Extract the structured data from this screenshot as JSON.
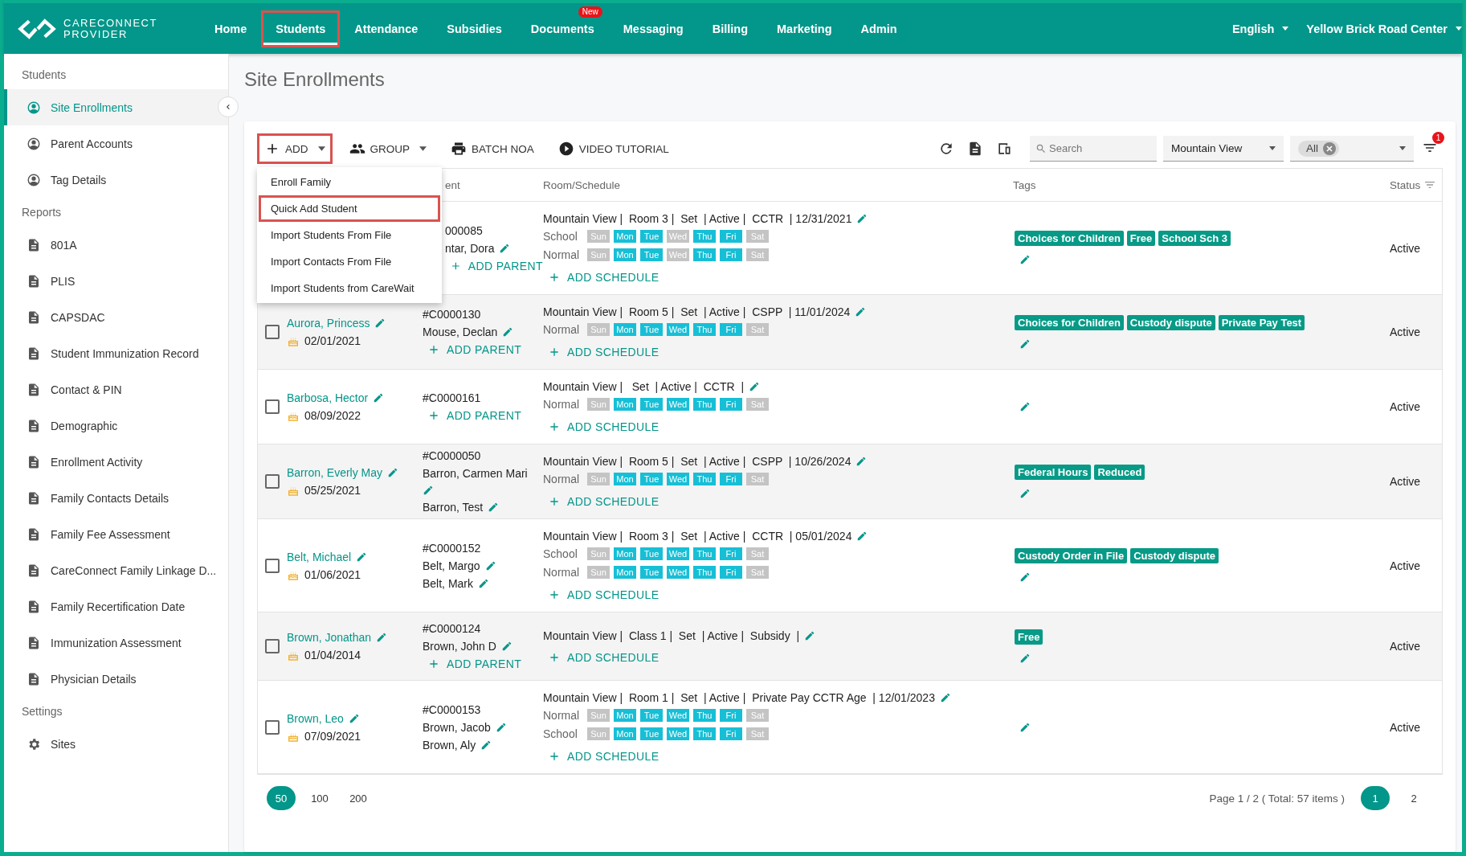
{
  "brand": {
    "line1": "CARECONNECT",
    "line2": "PROVIDER"
  },
  "nav": [
    {
      "label": "Home",
      "selected": false,
      "highlighted": false
    },
    {
      "label": "Students",
      "selected": true,
      "highlighted": true
    },
    {
      "label": "Attendance",
      "selected": false,
      "highlighted": false
    },
    {
      "label": "Subsidies",
      "selected": false,
      "highlighted": false
    },
    {
      "label": "Documents",
      "selected": false,
      "highlighted": false,
      "badge": "New"
    },
    {
      "label": "Messaging",
      "selected": false,
      "highlighted": false
    },
    {
      "label": "Billing",
      "selected": false,
      "highlighted": false
    },
    {
      "label": "Marketing",
      "selected": false,
      "highlighted": false
    },
    {
      "label": "Admin",
      "selected": false,
      "highlighted": false
    }
  ],
  "header_menus": [
    "English",
    "Yellow Brick Road Center"
  ],
  "sidebar": [
    {
      "heading": "Students",
      "items": [
        {
          "label": "Site Enrollments",
          "kind": "person",
          "selected": true
        },
        {
          "label": "Parent Accounts",
          "kind": "person",
          "selected": false
        },
        {
          "label": "Tag Details",
          "kind": "person",
          "selected": false
        }
      ]
    },
    {
      "heading": "Reports",
      "items": [
        {
          "label": "801A",
          "kind": "report",
          "selected": false
        },
        {
          "label": "PLIS",
          "kind": "report",
          "selected": false
        },
        {
          "label": "CAPSDAC",
          "kind": "report",
          "selected": false
        },
        {
          "label": "Student Immunization Record",
          "kind": "report",
          "selected": false
        },
        {
          "label": "Contact & PIN",
          "kind": "report",
          "selected": false
        },
        {
          "label": "Demographic",
          "kind": "report",
          "selected": false
        },
        {
          "label": "Enrollment Activity",
          "kind": "report",
          "selected": false
        },
        {
          "label": "Family Contacts Details",
          "kind": "report",
          "selected": false
        },
        {
          "label": "Family Fee Assessment",
          "kind": "report",
          "selected": false
        },
        {
          "label": "CareConnect Family Linkage D...",
          "kind": "report",
          "selected": false
        },
        {
          "label": "Family Recertification Date",
          "kind": "report",
          "selected": false
        },
        {
          "label": "Immunization Assessment",
          "kind": "report",
          "selected": false
        },
        {
          "label": "Physician Details",
          "kind": "report",
          "selected": false
        }
      ]
    },
    {
      "heading": "Settings",
      "items": [
        {
          "label": "Sites",
          "kind": "setting",
          "selected": false
        }
      ]
    }
  ],
  "page_title": "Site Enrollments",
  "toolbar": {
    "actions": [
      {
        "label": "ADD",
        "kind": "add",
        "highlighted": true
      },
      {
        "label": "GROUP",
        "kind": "group",
        "highlighted": false
      },
      {
        "label": "BATCH NOA",
        "kind": "print",
        "highlighted": false
      },
      {
        "label": "VIDEO TUTORIAL",
        "kind": "video",
        "highlighted": false
      }
    ],
    "search": {
      "placeholder": "Search"
    },
    "site": "Mountain View",
    "filter_chip": "All",
    "filter_badge": "1"
  },
  "add_menu": {
    "expanded": true,
    "items": [
      {
        "label": "Enroll Family",
        "highlighted": false
      },
      {
        "label": "Quick Add Student",
        "highlighted": true
      },
      {
        "label": "Import Students From File",
        "highlighted": false
      },
      {
        "label": "Import Contacts From File",
        "highlighted": false
      },
      {
        "label": "Import Students from CareWait",
        "highlighted": false
      }
    ]
  },
  "columns": {
    "parent": "ent",
    "schedule": "Room/Schedule",
    "tags": "Tags",
    "status": "Status"
  },
  "rows": [
    {
      "account": "000085",
      "parents": [
        "ntar, Dora"
      ],
      "add_parent": "ADD PARENT",
      "schedule_info": "Mountain View |  Room 3 |  Set  | Active |  CCTR  | 12/31/2021",
      "schedules": [
        {
          "label": "School",
          "days": [
            {
              "label": "Sun",
              "on": false
            },
            {
              "label": "Mon",
              "on": true
            },
            {
              "label": "Tue",
              "on": true
            },
            {
              "label": "Wed",
              "on": false
            },
            {
              "label": "Thu",
              "on": true
            },
            {
              "label": "Fri",
              "on": true
            },
            {
              "label": "Sat",
              "on": false
            }
          ]
        },
        {
          "label": "Normal",
          "days": [
            {
              "label": "Sun",
              "on": false
            },
            {
              "label": "Mon",
              "on": true
            },
            {
              "label": "Tue",
              "on": true
            },
            {
              "label": "Wed",
              "on": false
            },
            {
              "label": "Thu",
              "on": true
            },
            {
              "label": "Fri",
              "on": true
            },
            {
              "label": "Sat",
              "on": false
            }
          ]
        }
      ],
      "add_schedule": "ADD SCHEDULE",
      "tags": [
        "Choices for Children",
        "Free",
        "School Sch 3"
      ],
      "status": "Active"
    },
    {
      "checked": false,
      "name": "Aurora, Princess",
      "dob": "02/01/2021",
      "account": "#C0000130",
      "parents": [
        "Mouse, Declan"
      ],
      "add_parent": "ADD PARENT",
      "schedule_info": "Mountain View |  Room 5 |  Set  | Active |  CSPP  | 11/01/2024",
      "schedules": [
        {
          "label": "Normal",
          "days": [
            {
              "label": "Sun",
              "on": false
            },
            {
              "label": "Mon",
              "on": true
            },
            {
              "label": "Tue",
              "on": true
            },
            {
              "label": "Wed",
              "on": true
            },
            {
              "label": "Thu",
              "on": true
            },
            {
              "label": "Fri",
              "on": true
            },
            {
              "label": "Sat",
              "on": false
            }
          ]
        }
      ],
      "add_schedule": "ADD SCHEDULE",
      "tags": [
        "Choices for Children",
        "Custody dispute",
        "Private Pay Test"
      ],
      "status": "Active"
    },
    {
      "checked": false,
      "name": "Barbosa, Hector",
      "dob": "08/09/2022",
      "account": "#C0000161",
      "parents": [],
      "add_parent": "ADD PARENT",
      "schedule_info": "Mountain View |   Set  | Active |  CCTR  |",
      "schedules": [
        {
          "label": "Normal",
          "days": [
            {
              "label": "Sun",
              "on": false
            },
            {
              "label": "Mon",
              "on": true
            },
            {
              "label": "Tue",
              "on": true
            },
            {
              "label": "Wed",
              "on": true
            },
            {
              "label": "Thu",
              "on": true
            },
            {
              "label": "Fri",
              "on": true
            },
            {
              "label": "Sat",
              "on": false
            }
          ]
        }
      ],
      "add_schedule": "ADD SCHEDULE",
      "tags": [],
      "status": "Active"
    },
    {
      "checked": false,
      "name": "Barron, Everly May",
      "dob": "05/25/2021",
      "account": "#C0000050",
      "parents": [
        "Barron, Carmen Mari",
        "Barron, Test"
      ],
      "schedule_info": "Mountain View |  Room 5 |  Set  | Active |  CSPP  | 10/26/2024",
      "schedules": [
        {
          "label": "Normal",
          "days": [
            {
              "label": "Sun",
              "on": false
            },
            {
              "label": "Mon",
              "on": true
            },
            {
              "label": "Tue",
              "on": true
            },
            {
              "label": "Wed",
              "on": true
            },
            {
              "label": "Thu",
              "on": true
            },
            {
              "label": "Fri",
              "on": true
            },
            {
              "label": "Sat",
              "on": false
            }
          ]
        }
      ],
      "add_schedule": "ADD SCHEDULE",
      "tags": [
        "Federal Hours",
        "Reduced"
      ],
      "status": "Active"
    },
    {
      "checked": false,
      "name": "Belt, Michael",
      "dob": "01/06/2021",
      "account": "#C0000152",
      "parents": [
        "Belt, Margo",
        "Belt, Mark"
      ],
      "schedule_info": "Mountain View |  Room 3 |  Set  | Active |  CCTR  | 05/01/2024",
      "schedules": [
        {
          "label": "School",
          "days": [
            {
              "label": "Sun",
              "on": false
            },
            {
              "label": "Mon",
              "on": true
            },
            {
              "label": "Tue",
              "on": true
            },
            {
              "label": "Wed",
              "on": true
            },
            {
              "label": "Thu",
              "on": true
            },
            {
              "label": "Fri",
              "on": true
            },
            {
              "label": "Sat",
              "on": false
            }
          ]
        },
        {
          "label": "Normal",
          "days": [
            {
              "label": "Sun",
              "on": false
            },
            {
              "label": "Mon",
              "on": true
            },
            {
              "label": "Tue",
              "on": true
            },
            {
              "label": "Wed",
              "on": true
            },
            {
              "label": "Thu",
              "on": true
            },
            {
              "label": "Fri",
              "on": true
            },
            {
              "label": "Sat",
              "on": false
            }
          ]
        }
      ],
      "add_schedule": "ADD SCHEDULE",
      "tags": [
        "Custody Order in File",
        "Custody dispute"
      ],
      "status": "Active"
    },
    {
      "checked": false,
      "name": "Brown, Jonathan",
      "dob": "01/04/2014",
      "account": "#C0000124",
      "parents": [
        "Brown, John D"
      ],
      "add_parent": "ADD PARENT",
      "schedule_info": "Mountain View |  Class 1 |  Set  | Active |  Subsidy  |",
      "schedules": [],
      "add_schedule": "ADD SCHEDULE",
      "tags": [
        "Free"
      ],
      "status": "Active"
    },
    {
      "checked": false,
      "name": "Brown, Leo",
      "dob": "07/09/2021",
      "account": "#C0000153",
      "parents": [
        "Brown, Jacob",
        "Brown, Aly"
      ],
      "schedule_info": "Mountain View |  Room 1 |  Set  | Active |  Private Pay CCTR Age  | 12/01/2023",
      "schedules": [
        {
          "label": "Normal",
          "days": [
            {
              "label": "Sun",
              "on": false
            },
            {
              "label": "Mon",
              "on": true
            },
            {
              "label": "Tue",
              "on": true
            },
            {
              "label": "Wed",
              "on": true
            },
            {
              "label": "Thu",
              "on": true
            },
            {
              "label": "Fri",
              "on": true
            },
            {
              "label": "Sat",
              "on": false
            }
          ]
        },
        {
          "label": "School",
          "days": [
            {
              "label": "Sun",
              "on": false
            },
            {
              "label": "Mon",
              "on": true
            },
            {
              "label": "Tue",
              "on": true
            },
            {
              "label": "Wed",
              "on": true
            },
            {
              "label": "Thu",
              "on": true
            },
            {
              "label": "Fri",
              "on": true
            },
            {
              "label": "Sat",
              "on": false
            }
          ]
        }
      ],
      "add_schedule": "ADD SCHEDULE",
      "tags": [],
      "status": "Active"
    }
  ],
  "pagination": {
    "sizes": [
      {
        "label": "50",
        "selected": true
      },
      {
        "label": "100",
        "selected": false
      },
      {
        "label": "200",
        "selected": false
      }
    ],
    "summary": "Page 1 / 2 ( Total: 57 items )",
    "pages": [
      {
        "label": "1",
        "selected": true
      },
      {
        "label": "2",
        "selected": false
      }
    ]
  }
}
